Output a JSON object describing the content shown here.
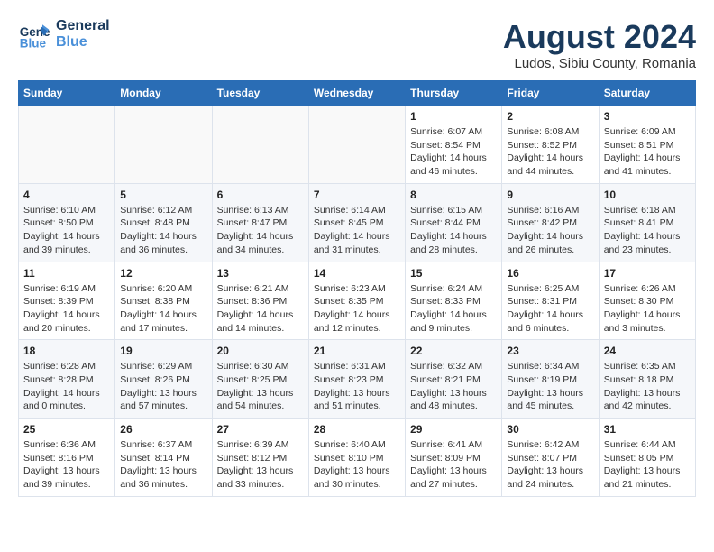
{
  "logo": {
    "line1": "General",
    "line2": "Blue"
  },
  "title": "August 2024",
  "subtitle": "Ludos, Sibiu County, Romania",
  "days_of_week": [
    "Sunday",
    "Monday",
    "Tuesday",
    "Wednesday",
    "Thursday",
    "Friday",
    "Saturday"
  ],
  "weeks": [
    [
      {
        "day": "",
        "info": ""
      },
      {
        "day": "",
        "info": ""
      },
      {
        "day": "",
        "info": ""
      },
      {
        "day": "",
        "info": ""
      },
      {
        "day": "1",
        "info": "Sunrise: 6:07 AM\nSunset: 8:54 PM\nDaylight: 14 hours\nand 46 minutes."
      },
      {
        "day": "2",
        "info": "Sunrise: 6:08 AM\nSunset: 8:52 PM\nDaylight: 14 hours\nand 44 minutes."
      },
      {
        "day": "3",
        "info": "Sunrise: 6:09 AM\nSunset: 8:51 PM\nDaylight: 14 hours\nand 41 minutes."
      }
    ],
    [
      {
        "day": "4",
        "info": "Sunrise: 6:10 AM\nSunset: 8:50 PM\nDaylight: 14 hours\nand 39 minutes."
      },
      {
        "day": "5",
        "info": "Sunrise: 6:12 AM\nSunset: 8:48 PM\nDaylight: 14 hours\nand 36 minutes."
      },
      {
        "day": "6",
        "info": "Sunrise: 6:13 AM\nSunset: 8:47 PM\nDaylight: 14 hours\nand 34 minutes."
      },
      {
        "day": "7",
        "info": "Sunrise: 6:14 AM\nSunset: 8:45 PM\nDaylight: 14 hours\nand 31 minutes."
      },
      {
        "day": "8",
        "info": "Sunrise: 6:15 AM\nSunset: 8:44 PM\nDaylight: 14 hours\nand 28 minutes."
      },
      {
        "day": "9",
        "info": "Sunrise: 6:16 AM\nSunset: 8:42 PM\nDaylight: 14 hours\nand 26 minutes."
      },
      {
        "day": "10",
        "info": "Sunrise: 6:18 AM\nSunset: 8:41 PM\nDaylight: 14 hours\nand 23 minutes."
      }
    ],
    [
      {
        "day": "11",
        "info": "Sunrise: 6:19 AM\nSunset: 8:39 PM\nDaylight: 14 hours\nand 20 minutes."
      },
      {
        "day": "12",
        "info": "Sunrise: 6:20 AM\nSunset: 8:38 PM\nDaylight: 14 hours\nand 17 minutes."
      },
      {
        "day": "13",
        "info": "Sunrise: 6:21 AM\nSunset: 8:36 PM\nDaylight: 14 hours\nand 14 minutes."
      },
      {
        "day": "14",
        "info": "Sunrise: 6:23 AM\nSunset: 8:35 PM\nDaylight: 14 hours\nand 12 minutes."
      },
      {
        "day": "15",
        "info": "Sunrise: 6:24 AM\nSunset: 8:33 PM\nDaylight: 14 hours\nand 9 minutes."
      },
      {
        "day": "16",
        "info": "Sunrise: 6:25 AM\nSunset: 8:31 PM\nDaylight: 14 hours\nand 6 minutes."
      },
      {
        "day": "17",
        "info": "Sunrise: 6:26 AM\nSunset: 8:30 PM\nDaylight: 14 hours\nand 3 minutes."
      }
    ],
    [
      {
        "day": "18",
        "info": "Sunrise: 6:28 AM\nSunset: 8:28 PM\nDaylight: 14 hours\nand 0 minutes."
      },
      {
        "day": "19",
        "info": "Sunrise: 6:29 AM\nSunset: 8:26 PM\nDaylight: 13 hours\nand 57 minutes."
      },
      {
        "day": "20",
        "info": "Sunrise: 6:30 AM\nSunset: 8:25 PM\nDaylight: 13 hours\nand 54 minutes."
      },
      {
        "day": "21",
        "info": "Sunrise: 6:31 AM\nSunset: 8:23 PM\nDaylight: 13 hours\nand 51 minutes."
      },
      {
        "day": "22",
        "info": "Sunrise: 6:32 AM\nSunset: 8:21 PM\nDaylight: 13 hours\nand 48 minutes."
      },
      {
        "day": "23",
        "info": "Sunrise: 6:34 AM\nSunset: 8:19 PM\nDaylight: 13 hours\nand 45 minutes."
      },
      {
        "day": "24",
        "info": "Sunrise: 6:35 AM\nSunset: 8:18 PM\nDaylight: 13 hours\nand 42 minutes."
      }
    ],
    [
      {
        "day": "25",
        "info": "Sunrise: 6:36 AM\nSunset: 8:16 PM\nDaylight: 13 hours\nand 39 minutes."
      },
      {
        "day": "26",
        "info": "Sunrise: 6:37 AM\nSunset: 8:14 PM\nDaylight: 13 hours\nand 36 minutes."
      },
      {
        "day": "27",
        "info": "Sunrise: 6:39 AM\nSunset: 8:12 PM\nDaylight: 13 hours\nand 33 minutes."
      },
      {
        "day": "28",
        "info": "Sunrise: 6:40 AM\nSunset: 8:10 PM\nDaylight: 13 hours\nand 30 minutes."
      },
      {
        "day": "29",
        "info": "Sunrise: 6:41 AM\nSunset: 8:09 PM\nDaylight: 13 hours\nand 27 minutes."
      },
      {
        "day": "30",
        "info": "Sunrise: 6:42 AM\nSunset: 8:07 PM\nDaylight: 13 hours\nand 24 minutes."
      },
      {
        "day": "31",
        "info": "Sunrise: 6:44 AM\nSunset: 8:05 PM\nDaylight: 13 hours\nand 21 minutes."
      }
    ]
  ]
}
